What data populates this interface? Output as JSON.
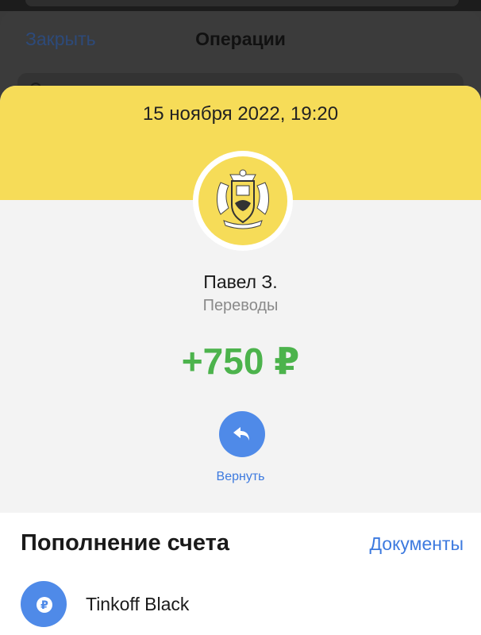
{
  "background": {
    "close_label": "Закрыть",
    "title": "Операции"
  },
  "operation": {
    "datetime": "15 ноября 2022, 19:20",
    "sender": "Павел З.",
    "category": "Переводы",
    "amount": "+750 ₽",
    "return_label": "Вернуть"
  },
  "details": {
    "title": "Пополнение счета",
    "documents_label": "Документы",
    "account_name": "Tinkoff Black",
    "account_icon_glyph": "₽"
  },
  "colors": {
    "header_yellow": "#f6dc58",
    "amount_green": "#4cb34c",
    "accent_blue": "#3d7adf"
  },
  "icons": {
    "bank_logo": "tinkoff-crest-icon",
    "return": "return-arrow-icon",
    "account": "ruble-icon",
    "search": "search-icon"
  }
}
